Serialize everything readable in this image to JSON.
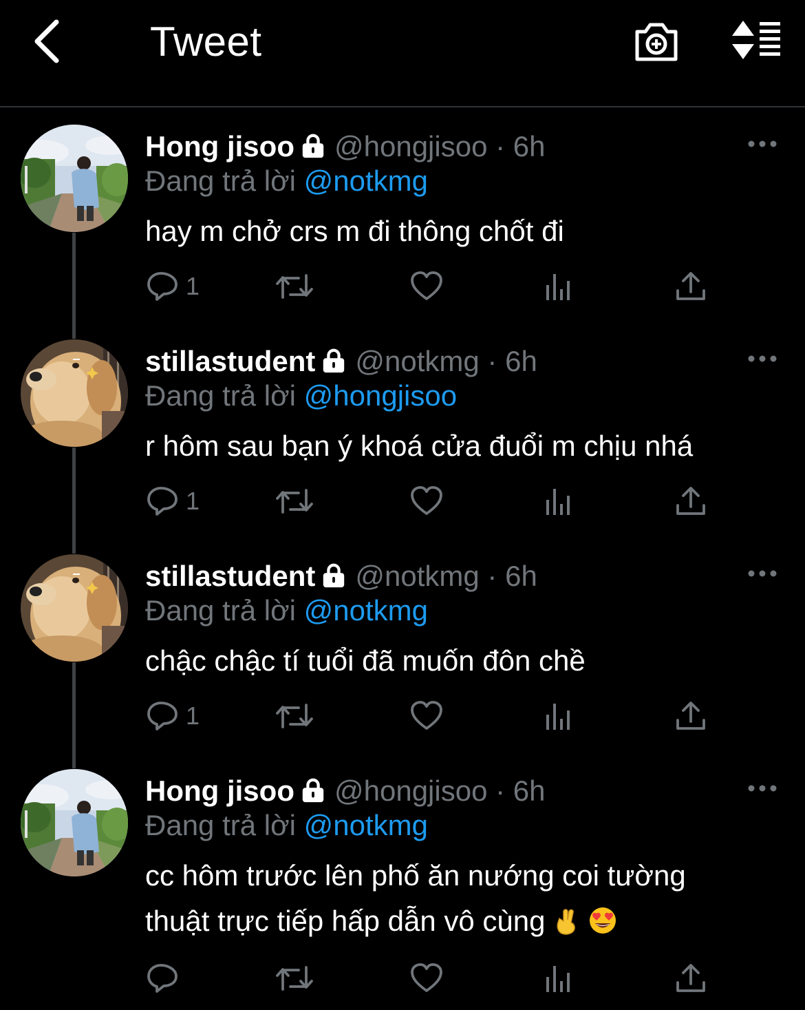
{
  "header": {
    "title": "Tweet"
  },
  "tweets": [
    {
      "name": "Hong jisoo",
      "handle": "@hongjisoo",
      "separator": "·",
      "time": "6h",
      "reply_prefix": "Đang trả lời",
      "reply_to": "@notkmg",
      "text": "hay m chở crs m đi thông chốt đi",
      "reply_count": "1"
    },
    {
      "name": "stillastudent",
      "handle": "@notkmg",
      "separator": "·",
      "time": "6h",
      "reply_prefix": "Đang trả lời",
      "reply_to": "@hongjisoo",
      "text": "r hôm sau bạn ý khoá cửa đuổi m chịu nhá",
      "reply_count": "1"
    },
    {
      "name": "stillastudent",
      "handle": "@notkmg",
      "separator": "·",
      "time": "6h",
      "reply_prefix": "Đang trả lời",
      "reply_to": "@notkmg",
      "text": "chậc chậc tí tuổi đã muốn đôn chề",
      "reply_count": "1"
    },
    {
      "name": "Hong jisoo",
      "handle": "@hongjisoo",
      "separator": "·",
      "time": "6h",
      "reply_prefix": "Đang trả lời",
      "reply_to": "@notkmg",
      "text_line1": "cc hôm trước lên phố ăn nướng coi tường",
      "text_line2": "thuật trực tiếp hấp dẫn vô cùng",
      "reply_count": ""
    }
  ],
  "colors": {
    "background": "#000000",
    "accent": "#1d9bf0",
    "muted": "#71767b",
    "text": "#ffffff"
  },
  "icons": [
    "back-chevron-icon",
    "camera-plus-icon",
    "sort-icon",
    "lock-icon",
    "more-icon",
    "reply-icon",
    "retweet-icon",
    "like-icon",
    "views-icon",
    "share-icon",
    "fingers-crossed-emoji",
    "heart-eyes-emoji"
  ]
}
